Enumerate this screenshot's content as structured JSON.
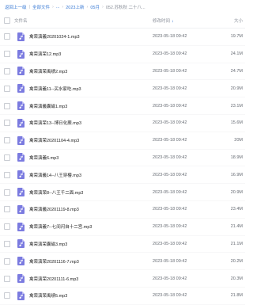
{
  "breadcrumb": {
    "back": "返回上一级",
    "items": [
      "全部文件",
      "...",
      "2023上新",
      "05月",
      "052.苏秋秋 二十八..."
    ]
  },
  "table": {
    "headers": {
      "name": "文件名",
      "time": "修改时间",
      "size": "大小"
    },
    "rows": [
      {
        "name": "禽荣演義20201024-1.mp3",
        "time": "2023-05-18 09:42",
        "size": "19.7M"
      },
      {
        "name": "禽荣演荣12.mp3",
        "time": "2023-05-18 09:42",
        "size": "24.1M"
      },
      {
        "name": "禽荣演荣禹绩2.mp3",
        "time": "2023-05-18 09:42",
        "size": "24.7M"
      },
      {
        "name": "禽荣演義11--买水家吃.mp3",
        "time": "2023-05-18 09:42",
        "size": "20.9M"
      },
      {
        "name": "禽荣演義囊磁1.mp3",
        "time": "2023-05-18 09:42",
        "size": "23.1M"
      },
      {
        "name": "禽荣演荣13--博日化蕨.mp3",
        "time": "2023-05-18 09:42",
        "size": "15.6M"
      },
      {
        "name": "禽荣演荣20201104-4.mp3",
        "time": "2023-05-18 09:42",
        "size": "20M"
      },
      {
        "name": "禽荣演義6.mp3",
        "time": "2023-05-18 09:42",
        "size": "18.9M"
      },
      {
        "name": "禽荣演義14--八王穿樓.mp3",
        "time": "2023-05-18 09:42",
        "size": "16.9M"
      },
      {
        "name": "禽荣演荣8--八王千二面.mp3",
        "time": "2023-05-18 09:42",
        "size": "20.9M"
      },
      {
        "name": "禽荣演義20201119-8.mp3",
        "time": "2023-05-18 09:42",
        "size": "23.4M"
      },
      {
        "name": "禽荣演義7--七间闪自十二宫.mp3",
        "time": "2023-05-18 09:42",
        "size": "21.4M"
      },
      {
        "name": "禽荣演荣囊磁3.mp3",
        "time": "2023-05-18 09:42",
        "size": "21.1M"
      },
      {
        "name": "禽荣演荣20201116-7.mp3",
        "time": "2023-05-18 09:42",
        "size": "20.2M"
      },
      {
        "name": "禽荣演荣20201111-6.mp3",
        "time": "2023-05-18 09:42",
        "size": "20.3M"
      },
      {
        "name": "禽荣演荣禹绩5.mp3",
        "time": "2023-05-18 09:42",
        "size": "21.8M"
      }
    ]
  },
  "colors": {
    "link": "#3a7bd5",
    "icon_bg": "#7b7be0"
  },
  "icons": {
    "file": "audio-file-icon",
    "sort": "sort-down-icon"
  }
}
